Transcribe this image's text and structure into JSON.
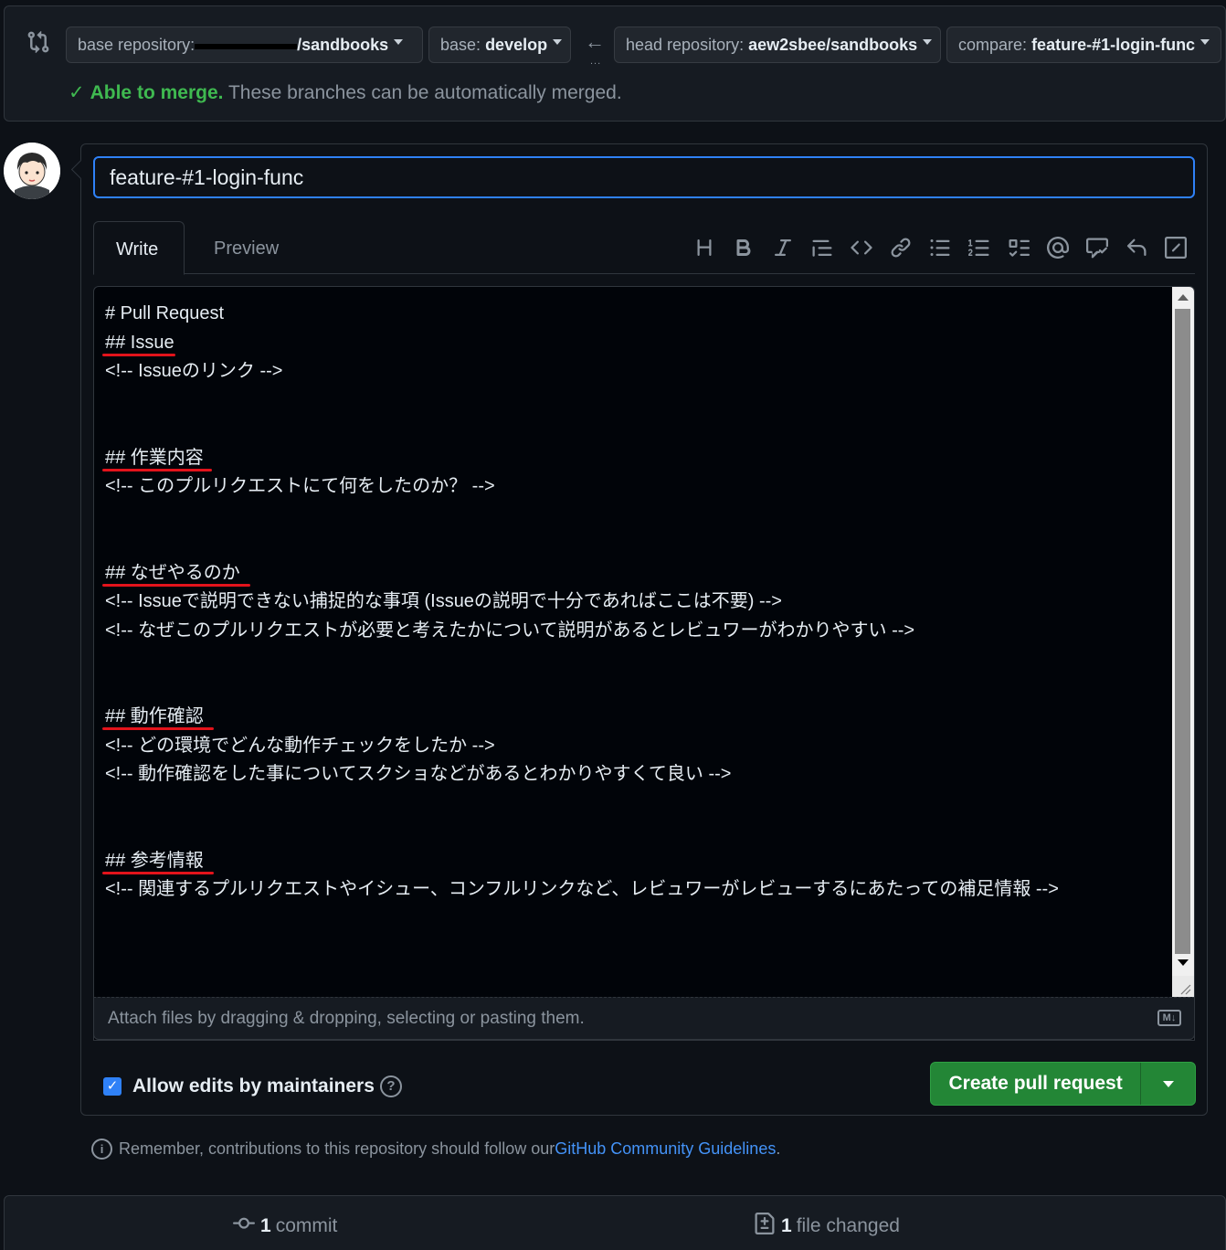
{
  "compare": {
    "base_repo_prefix": "base repository:",
    "base_repo_value_tail": "/sandbooks",
    "base_prefix": "base:",
    "base_value": "develop",
    "head_repo_prefix": "head repository:",
    "head_repo_value": "aew2sbee/sandbooks",
    "compare_prefix": "compare:",
    "compare_value": "feature-#1-login-func",
    "arrow": "←",
    "dots": "...",
    "merge_check": "✓",
    "merge_ok": "Able to merge.",
    "merge_msg": " These branches can be automatically merged."
  },
  "form": {
    "title_value": "feature-#1-login-func",
    "tabs": {
      "write": "Write",
      "preview": "Preview"
    },
    "toolbar_icons": [
      "heading-icon",
      "bold-icon",
      "italic-icon",
      "quote-icon",
      "code-icon",
      "link-icon",
      "unordered-list-icon",
      "ordered-list-icon",
      "task-list-icon",
      "mention-icon",
      "reference-icon",
      "reply-icon",
      "slash-commands-icon"
    ],
    "body_lines": [
      "# Pull Request",
      "## Issue",
      "<!-- Issueのリンク -->",
      "",
      "",
      "## 作業内容",
      "<!-- このプルリクエストにて何をしたのか？ -->",
      "",
      "",
      "## なぜやるのか",
      "<!-- Issueで説明できない捕捉的な事項 (Issueの説明で十分であればここは不要) -->",
      "<!-- なぜこのプルリクエストが必要と考えたかについて説明があるとレビュワーがわかりやすい -->",
      "",
      "",
      "## 動作確認",
      "<!-- どの環境でどんな動作チェックをしたか -->",
      "<!-- 動作確認をした事についてスクショなどがあるとわかりやすくて良い -->",
      "",
      "",
      "## 参考情報",
      "<!-- 関連するプルリクエストやイシュー、コンフルリンクなど、レビュワーがレビューするにあたっての補足情報 -->"
    ],
    "attach_text": "Attach files by dragging & dropping, selecting or pasting them.",
    "md_badge": "M↓",
    "allow_edits_label": "Allow edits by maintainers",
    "help_glyph": "?",
    "create_button": "Create pull request"
  },
  "guideline": {
    "info_glyph": "i",
    "text": "Remember, contributions to this repository should follow our ",
    "link": "GitHub Community Guidelines",
    "end": "."
  },
  "summary": {
    "commits_num": "1",
    "commits_label": "commit",
    "files_num": "1",
    "files_label": "file changed"
  },
  "colors": {
    "accent_blue": "#2f81f7",
    "merge_green": "#3fb950",
    "create_green": "#238636",
    "annotation_red": "#e3131b"
  }
}
